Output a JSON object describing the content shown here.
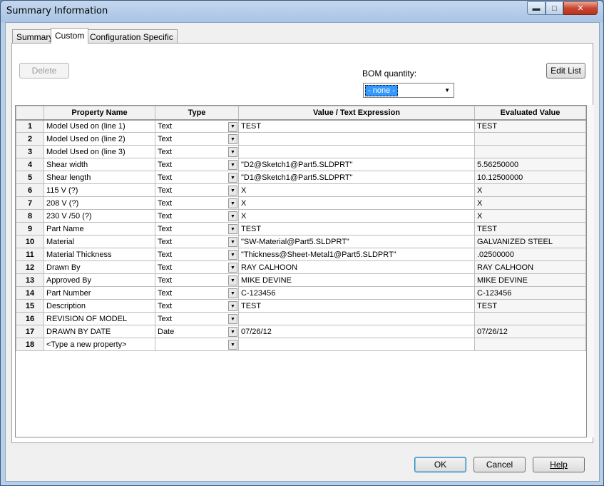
{
  "window": {
    "title": "Summary Information",
    "min_glyph": "▬",
    "max_glyph": "□",
    "close_glyph": "✕"
  },
  "tabs": [
    {
      "label": "Summary"
    },
    {
      "label": "Custom"
    },
    {
      "label": "Configuration Specific"
    }
  ],
  "toolbar": {
    "delete_label": "Delete",
    "bom_label": "BOM quantity:",
    "bom_value": "- none -",
    "edit_list_label": "Edit List"
  },
  "grid": {
    "headers": [
      "",
      "Property Name",
      "Type",
      "Value / Text Expression",
      "Evaluated Value"
    ],
    "rows": [
      {
        "n": "1",
        "name": "Model Used on (line 1)",
        "type": "Text",
        "value": " TEST",
        "eval": " TEST"
      },
      {
        "n": "2",
        "name": "Model Used on (line 2)",
        "type": "Text",
        "value": "",
        "eval": ""
      },
      {
        "n": "3",
        "name": "Model Used on (line 3)",
        "type": "Text",
        "value": "",
        "eval": ""
      },
      {
        "n": "4",
        "name": "Shear width",
        "type": "Text",
        "value": "\"D2@Sketch1@Part5.SLDPRT\"",
        "eval": "5.56250000"
      },
      {
        "n": "5",
        "name": "Shear length",
        "type": "Text",
        "value": "\"D1@Sketch1@Part5.SLDPRT\"",
        "eval": "10.12500000"
      },
      {
        "n": "6",
        "name": "115 V (?)",
        "type": "Text",
        "value": "X",
        "eval": "X"
      },
      {
        "n": "7",
        "name": "208 V (?)",
        "type": "Text",
        "value": "X",
        "eval": "X"
      },
      {
        "n": "8",
        "name": "230 V /50 (?)",
        "type": "Text",
        "value": "X",
        "eval": "X"
      },
      {
        "n": "9",
        "name": "Part Name",
        "type": "Text",
        "value": " TEST",
        "eval": " TEST"
      },
      {
        "n": "10",
        "name": "Material",
        "type": "Text",
        "value": "\"SW-Material@Part5.SLDPRT\"",
        "eval": "GALVANIZED STEEL"
      },
      {
        "n": "11",
        "name": "Material Thickness",
        "type": "Text",
        "value": "\"Thickness@Sheet-Metal1@Part5.SLDPRT\"",
        "eval": ".02500000"
      },
      {
        "n": "12",
        "name": "Drawn By",
        "type": "Text",
        "value": "RAY CALHOON",
        "eval": "RAY CALHOON"
      },
      {
        "n": "13",
        "name": "Approved By",
        "type": "Text",
        "value": "MIKE DEVINE",
        "eval": "MIKE DEVINE"
      },
      {
        "n": "14",
        "name": "Part Number",
        "type": "Text",
        "value": " C-123456",
        "eval": " C-123456"
      },
      {
        "n": "15",
        "name": "Description",
        "type": "Text",
        "value": "TEST",
        "eval": "TEST"
      },
      {
        "n": "16",
        "name": "REVISION OF MODEL",
        "type": "Text",
        "value": "",
        "eval": ""
      },
      {
        "n": "17",
        "name": "DRAWN BY DATE",
        "type": "Date",
        "value": "07/26/12",
        "eval": "07/26/12"
      },
      {
        "n": "18",
        "name": "<Type a new property>",
        "type": "",
        "value": "",
        "eval": ""
      }
    ]
  },
  "footer": {
    "ok_label": "OK",
    "cancel_label": "Cancel",
    "help_label": "Help"
  }
}
